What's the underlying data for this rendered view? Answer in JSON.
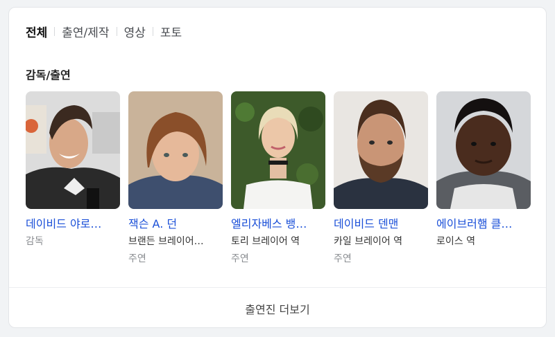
{
  "tabs": [
    {
      "label": "전체",
      "active": true
    },
    {
      "label": "출연/제작",
      "active": false
    },
    {
      "label": "영상",
      "active": false
    },
    {
      "label": "포토",
      "active": false
    }
  ],
  "section_title": "감독/출연",
  "people": [
    {
      "name": "데이비드 야로…",
      "role": "감독",
      "type": ""
    },
    {
      "name": "잭슨 A. 던",
      "role": "브랜든 브레이어…",
      "type": "주연"
    },
    {
      "name": "엘리자베스 뱅…",
      "role": "토리 브레이어 역",
      "type": "주연"
    },
    {
      "name": "데이비드 덴맨",
      "role": "카일 브레이어 역",
      "type": "주연"
    },
    {
      "name": "에이브러햄 클…",
      "role": "로이스 역",
      "type": ""
    }
  ],
  "more_label": "출연진 더보기",
  "colors": {
    "link": "#1a4fd8",
    "muted": "#8a8d91",
    "background": "#f1f3f5"
  }
}
